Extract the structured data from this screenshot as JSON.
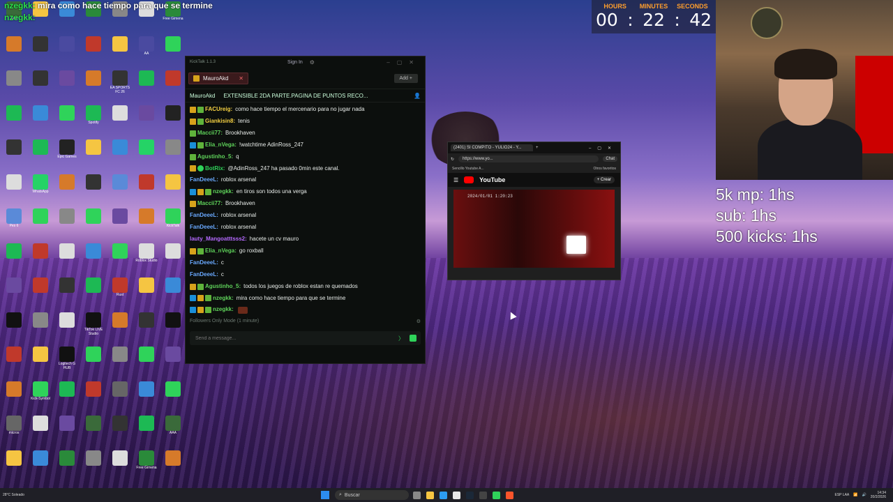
{
  "overlay_chat": [
    {
      "user": "nzegkk:",
      "text": "mira como hace tiempo para que se termine"
    },
    {
      "user": "nzegkk:",
      "text": ""
    }
  ],
  "timer": {
    "hours_label": "HOURS",
    "minutes_label": "MINUTES",
    "seconds_label": "SECONDS",
    "hours": "00",
    "minutes": "22",
    "seconds": "42"
  },
  "goals": [
    "5k mp: 1hs",
    "sub: 1hs",
    "500 kicks: 1hs"
  ],
  "kicktalk": {
    "title": "KickTalk 1.1.3",
    "sign_in": "Sign In",
    "tab_name": "MauroAkd",
    "add_label": "Add +",
    "channel": "MauroAkd",
    "stream_title": "EXTENSIBLE 2DA PARTE.PAGINA DE PUNTOS RECO...",
    "followers_mode": "Followers Only Mode (1 minute)",
    "input_placeholder": "Send a message...",
    "messages": [
      {
        "badges": [
          "gold",
          "green"
        ],
        "user": "FACUreig:",
        "color": "#f5d142",
        "text": "como hace tiempo el mercenario para no jugar nada"
      },
      {
        "badges": [
          "gold",
          "green"
        ],
        "user": "Giankisin8:",
        "color": "#f5d142",
        "text": "tenis"
      },
      {
        "badges": [
          "green"
        ],
        "user": "Maccii77:",
        "color": "#5fd35a",
        "text": "Brookhaven"
      },
      {
        "badges": [
          "blue",
          "green"
        ],
        "user": "Elia_nVega:",
        "color": "#5fd35a",
        "text": "!watchtime AdinRoss_247"
      },
      {
        "badges": [
          "green"
        ],
        "user": "Agustinho_5:",
        "color": "#5fd35a",
        "text": "q"
      },
      {
        "badges": [
          "gold",
          "lime"
        ],
        "user": "BotRix:",
        "color": "#2fd35a",
        "text": "@AdinRoss_247 ha pasado 0min    este canal."
      },
      {
        "badges": [],
        "user": "FanDeeeL:",
        "color": "#6aa9ff",
        "text": "roblox arsenal"
      },
      {
        "badges": [
          "blue",
          "gold",
          "green"
        ],
        "user": "nzegkk:",
        "color": "#5fd35a",
        "text": "en tiros son todos una verga"
      },
      {
        "badges": [
          "gold"
        ],
        "user": "Maccii77:",
        "color": "#5fd35a",
        "text": "Brookhaven"
      },
      {
        "badges": [],
        "user": "FanDeeeL:",
        "color": "#6aa9ff",
        "text": "roblox arsenal"
      },
      {
        "badges": [],
        "user": "FanDeeeL:",
        "color": "#6aa9ff",
        "text": "roblox arsenal"
      },
      {
        "badges": [],
        "user": "lauty_Mangoatttsss2:",
        "color": "#b56aff",
        "text": "hacete un cv mauro"
      },
      {
        "badges": [
          "gold",
          "green"
        ],
        "user": "Elia_nVega:",
        "color": "#5fd35a",
        "text": "go roxball"
      },
      {
        "badges": [],
        "user": "FanDeeeL:",
        "color": "#6aa9ff",
        "text": "c"
      },
      {
        "badges": [],
        "user": "FanDeeeL:",
        "color": "#6aa9ff",
        "text": "c"
      },
      {
        "badges": [
          "gold",
          "green"
        ],
        "user": "Agustinho_5:",
        "color": "#5fd35a",
        "text": "todos los juegos de roblox estan re quemados"
      },
      {
        "badges": [
          "blue",
          "gold",
          "green"
        ],
        "user": "nzegkk:",
        "color": "#5fd35a",
        "text": "mira como hace tiempo para que se termine"
      },
      {
        "badges": [
          "blue",
          "gold",
          "green"
        ],
        "user": "nzegkk:",
        "color": "#5fd35a",
        "text": ""
      }
    ]
  },
  "browser": {
    "tab_title": "(2401) SI COMPITO - YULIO24 - Y...",
    "url": "https://www.yo...",
    "chat_label": "Chat",
    "bookmark": "Sencillo Youtube A...",
    "favorites": "Otros favoritos",
    "youtube": "YouTube",
    "crear": "+ Crear",
    "video_timestamp": "2024/01/01 1:20:23"
  },
  "desktop_icons": [
    {
      "label": "AAA",
      "color": "#3a6a3a"
    },
    {
      "label": "Free Gimena",
      "color": "#2a8a3a"
    },
    {
      "label": "AA",
      "color": "#4a4aa0"
    },
    {
      "label": "EA SPORTS FC 26",
      "color": "#333"
    },
    {
      "label": "Spotify",
      "color": "#1db954"
    },
    {
      "label": "Epic Games",
      "color": "#222"
    },
    {
      "label": "WhatsApp",
      "color": "#25d366"
    },
    {
      "label": "Pes 6",
      "color": "#5a8ad8"
    },
    {
      "label": "KickTalk",
      "color": "#2fd35a"
    },
    {
      "label": "Roblox Studio",
      "color": "#ddd"
    },
    {
      "label": "Rust",
      "color": "#c0392b"
    },
    {
      "label": "TikTok LIVE Studio",
      "color": "#111"
    },
    {
      "label": "Logitech G HUB",
      "color": "#111"
    },
    {
      "label": "Kick-Symbol",
      "color": "#2fd35a"
    },
    {
      "label": "micros",
      "color": "#666"
    }
  ],
  "taskbar": {
    "weather": "28°C Soleado",
    "search": "Buscar",
    "lang": "ESP LAA",
    "time": "14:34",
    "date": "20/2/2026"
  }
}
